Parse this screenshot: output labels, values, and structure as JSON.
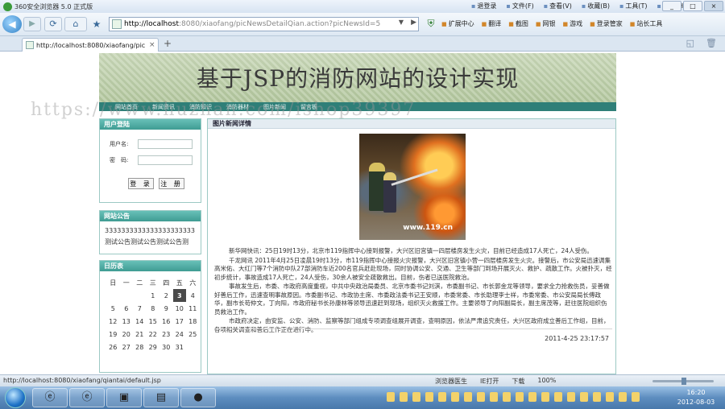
{
  "browser": {
    "title": "360安全浏览器 5.0 正式版",
    "menus": [
      "退登录",
      "文件(F)",
      "查看(V)",
      "收藏(B)",
      "工具(T)",
      "帮助(H)"
    ],
    "win_buttons": [
      "_",
      "□",
      "×"
    ],
    "address": {
      "host": "http://localhost",
      "path": ":8080/xiaofang/picNewsDetailQian.action?picNewsId=5"
    },
    "toolbar_right": [
      "扩展中心",
      "翻译",
      "截图",
      "网银",
      "游戏",
      "登录管家",
      "站长工具"
    ],
    "tab": {
      "label": "http://localhost:8080/xiaofang/pic...",
      "close": "×"
    },
    "new_tab": "+"
  },
  "site": {
    "title": "基于JSP的消防网站的设计实现",
    "watermark": "https://www.huzhan.com/ishop39397",
    "nav": [
      "网站首页",
      "新闻资讯",
      "消防知识",
      "消防器材",
      "图片新闻",
      "留言板"
    ]
  },
  "login": {
    "header": "用户登陆",
    "username_label": "用户名:",
    "password_label": "密　码:",
    "login_button": "登 录",
    "register_button": "注 册"
  },
  "notice": {
    "header": "网站公告",
    "text": "3333333333333333333333测试公告测试公告测试公告测"
  },
  "calendar": {
    "header": "日历表",
    "weekdays": [
      "日",
      "一",
      "二",
      "三",
      "四",
      "五",
      "六"
    ],
    "weeks": [
      [
        "",
        "",
        "",
        "1",
        "2",
        "3",
        "4"
      ],
      [
        "5",
        "6",
        "7",
        "8",
        "9",
        "10",
        "11"
      ],
      [
        "12",
        "13",
        "14",
        "15",
        "16",
        "17",
        "18"
      ],
      [
        "19",
        "20",
        "21",
        "22",
        "23",
        "24",
        "25"
      ],
      [
        "26",
        "27",
        "28",
        "29",
        "30",
        "31",
        ""
      ]
    ],
    "today": "3"
  },
  "news": {
    "header": "图片新闻详情",
    "photo_mark": "www.119.cn",
    "paragraphs": [
      "新华网快讯：25日19时13分，北京市119指挥中心接到报警，大兴区旧宫镇一四层楼房发生火灾，目前已经造成17人死亡，24人受伤。",
      "千龙网讯 2011年4月25日凌晨19时13分，市119指挥中心接报火灾报警，大兴区旧宫镇小营一四层楼房发生火灾。接警后，市公安局迅速调集高米佑、大红门等7个消防中队27部消防车近200名官兵赶赴现场，同时协调公安、交通、卫生等部门到场开展灭火、救护、疏散工作。火被扑灭，经初步统计，事故造成17人死亡，24人受伤，30余人被安全疏散救出。目前，伤者已送医院救治。",
      "事故发生后，市委、市政府高度重视，中共中央政治局委员、北京市委书记刘淇，市委副书记、市长郭金龙等领导，要求全力抢救伤员，妥善做好善后工作，迅速查明事故原因。市委副书记、市政协主席、市委政法委书记王安顺，市委常委、市长助理李士祥，市委常委、市公安局局长傅政华，副市长苟仲文，丁向阳，市政府秘书长孙康林等领导迅速赶到现场，组织灭火救援工作。主要领导了向阳副局长，副主席茂等，赶往医院组织伤员救治工作。",
      "市政府决定，由安监、公安、消防、监察等部门组成专项调查组展开调查，查明原因，依法严肃追究责任，大兴区政府成立善后工作组，目前，各项相关调查和善后工作正在进行中。"
    ],
    "date": "2011-4-25 23:17:57"
  },
  "statusbar": {
    "url": "http://localhost:8080/xiaofang/qiantai/default.jsp",
    "items": [
      "浏览器医生",
      "IE打开",
      "下载",
      "100%"
    ]
  },
  "taskbar": {
    "time": "16:20",
    "date": "2012-08-03"
  }
}
